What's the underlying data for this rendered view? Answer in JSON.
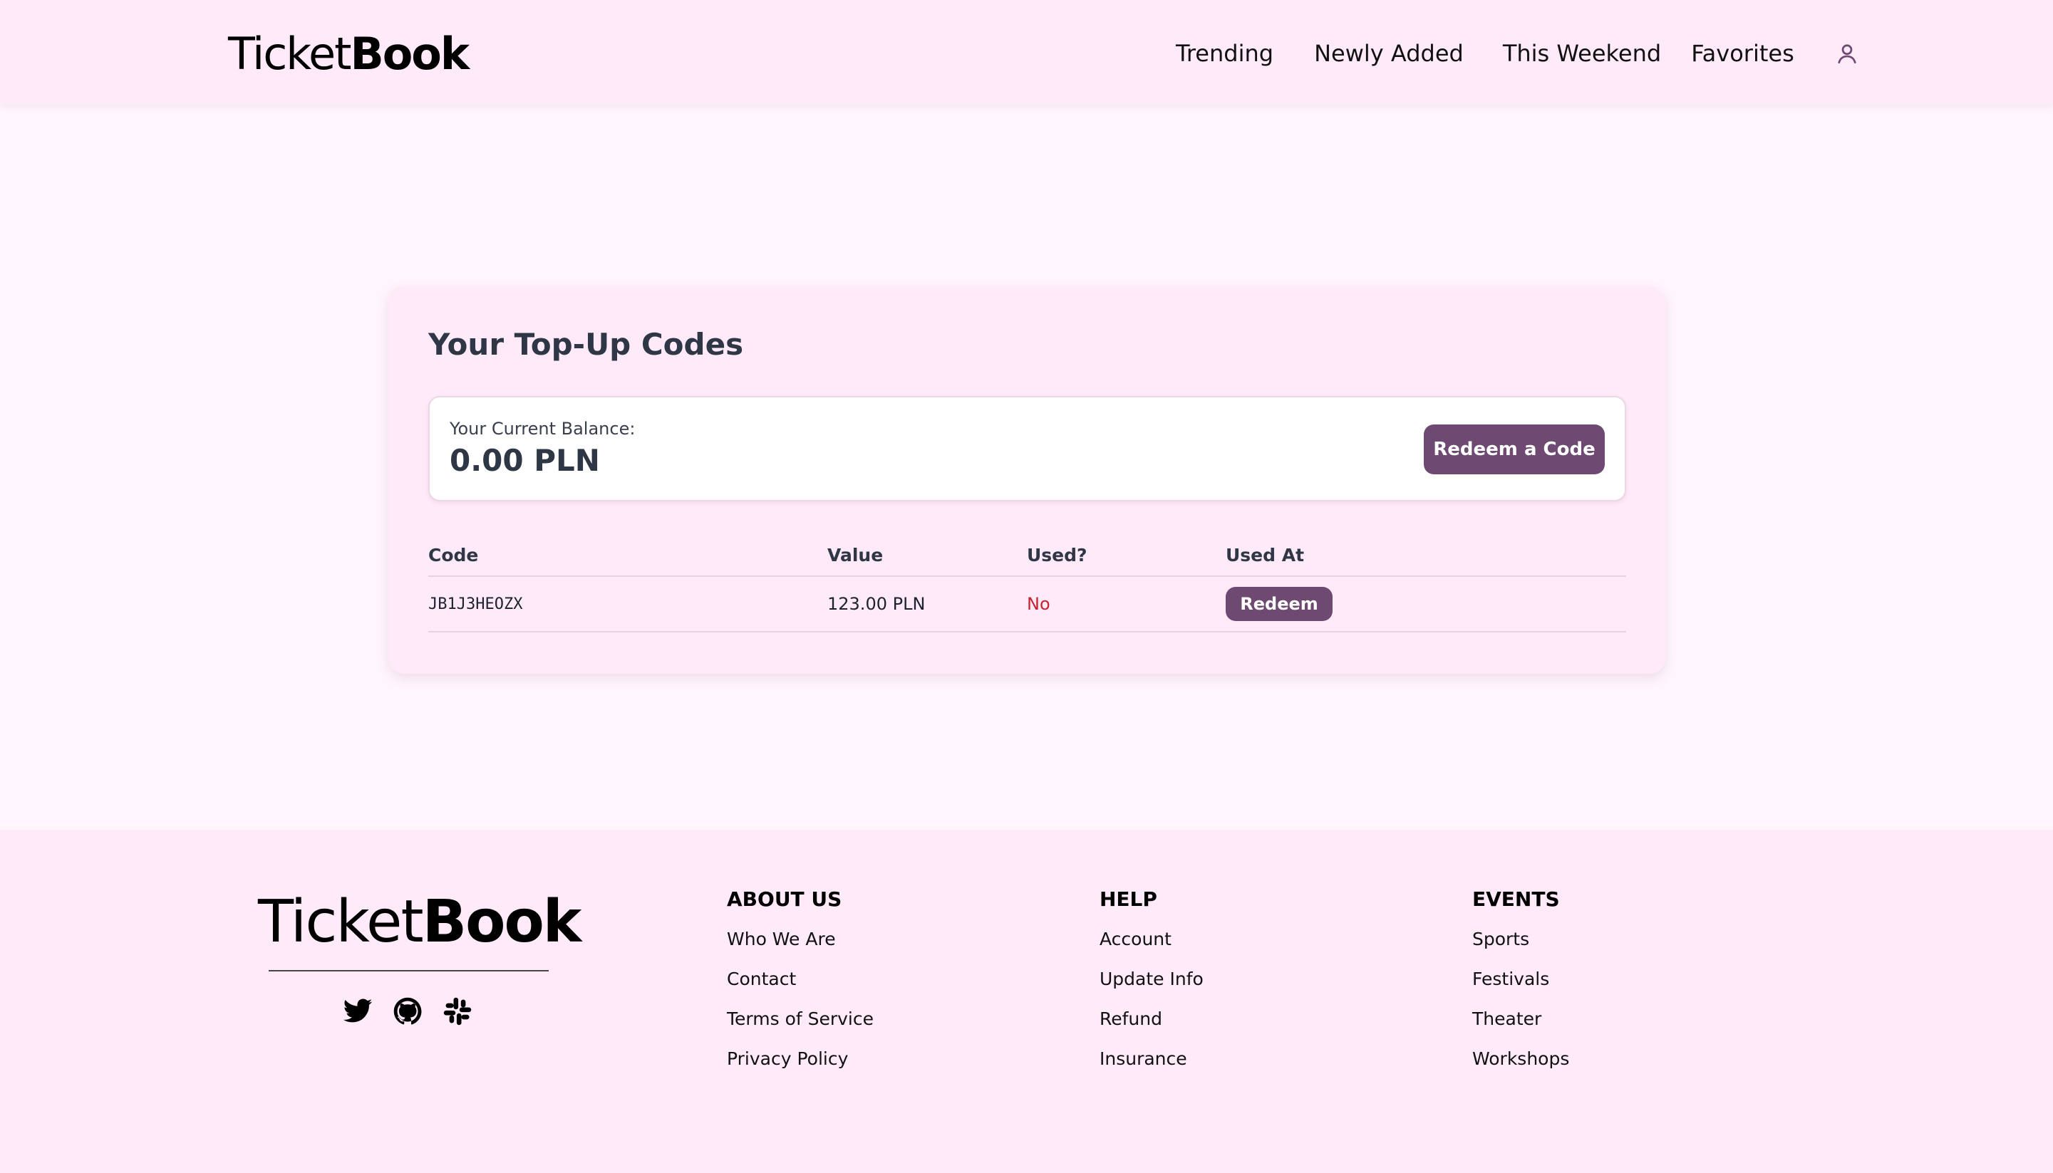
{
  "header": {
    "logo_light": "Ticket",
    "logo_bold": "Book",
    "nav": [
      {
        "label": "Trending"
      },
      {
        "label": "Newly Added"
      },
      {
        "label": "This Weekend"
      },
      {
        "label": "Favorites"
      }
    ],
    "user_icon": "user-icon"
  },
  "card": {
    "title": "Your Top-Up Codes",
    "balance_label": "Your Current Balance:",
    "balance_value": "0.00 PLN",
    "redeem_code_label": "Redeem a Code",
    "columns": [
      "Code",
      "Value",
      "Used?",
      "Used At"
    ],
    "rows": [
      {
        "code": "JB1J3HEOZX",
        "value": "123.00 PLN",
        "used": "No",
        "action": "Redeem"
      }
    ]
  },
  "footer": {
    "logo_light": "Ticket",
    "logo_bold": "Book",
    "socials": [
      "twitter-icon",
      "github-icon",
      "slack-icon"
    ],
    "columns": [
      {
        "heading": "ABOUT US",
        "links": [
          "Who We Are",
          "Contact",
          "Terms of Service",
          "Privacy Policy"
        ]
      },
      {
        "heading": "HELP",
        "links": [
          "Account",
          "Update Info",
          "Refund",
          "Insurance"
        ]
      },
      {
        "heading": "EVENTS",
        "links": [
          "Sports",
          "Festivals",
          "Theater",
          "Workshops"
        ]
      }
    ]
  },
  "colors": {
    "page_bg": "#fff5fc",
    "panel_bg": "#ffeaf9",
    "button": "#6e4a72",
    "used_no": "#c8222f"
  }
}
